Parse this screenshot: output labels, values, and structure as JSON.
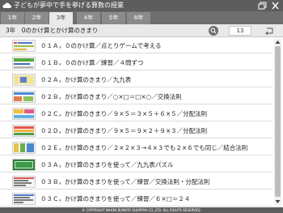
{
  "app": {
    "title": "子どもが夢中で手を挙げる算数の授業"
  },
  "tabs": [
    {
      "label": "1年"
    },
    {
      "label": "2年"
    },
    {
      "label": "3年",
      "active": true
    },
    {
      "label": "4年"
    },
    {
      "label": "5年"
    },
    {
      "label": "6年"
    }
  ],
  "subheader": {
    "title": "3年　0のかけ算とかけ算のきまり",
    "count": "13"
  },
  "lessons": [
    {
      "label": "０１Ａ，０のかけ算／点とりゲームで考える"
    },
    {
      "label": "０１Ｂ，０のかけ算／練習／４問ずつ"
    },
    {
      "label": "０２Ａ，かけ算のきまり／九九表"
    },
    {
      "label": "０２Ｂ，かけ算のきまり／○×□＝□×○／交換法則"
    },
    {
      "label": "０２Ｃ，かけ算のきまり／９×５＝３×５＋６×５／分配法則"
    },
    {
      "label": "０２Ｄ，かけ算のきまり／９×５＝９×２＋９×３／分配法則"
    },
    {
      "label": "０２Ｅ，かけ算のきまり／２×２×３→４×３でも２×６でも同じ／結合法則"
    },
    {
      "label": "０３Ａ，かけ算のきまりを使って／九九表パズル"
    },
    {
      "label": "０３Ｂ，かけ算のきまりを使って／練習／交換法則・分配法則"
    },
    {
      "label": "０３Ｃ，かけ算のきまりを使って／練習／６×□＝２４"
    }
  ],
  "footer": {
    "copyright": "© COPYRIGHT NIHON BUNKYO SHUPPAN CO.,LTD. ALL RIGHTS RESERVED."
  },
  "colors": {
    "titlebar": "#5d5d5d",
    "tabbar": "#6e6e6e",
    "active_tab": "#e9e9e9"
  },
  "icons": {
    "app": "cloud-icon",
    "restore": "restore-window-icon",
    "close": "close-icon",
    "search": "search-icon",
    "back": "return-arrow-icon"
  }
}
